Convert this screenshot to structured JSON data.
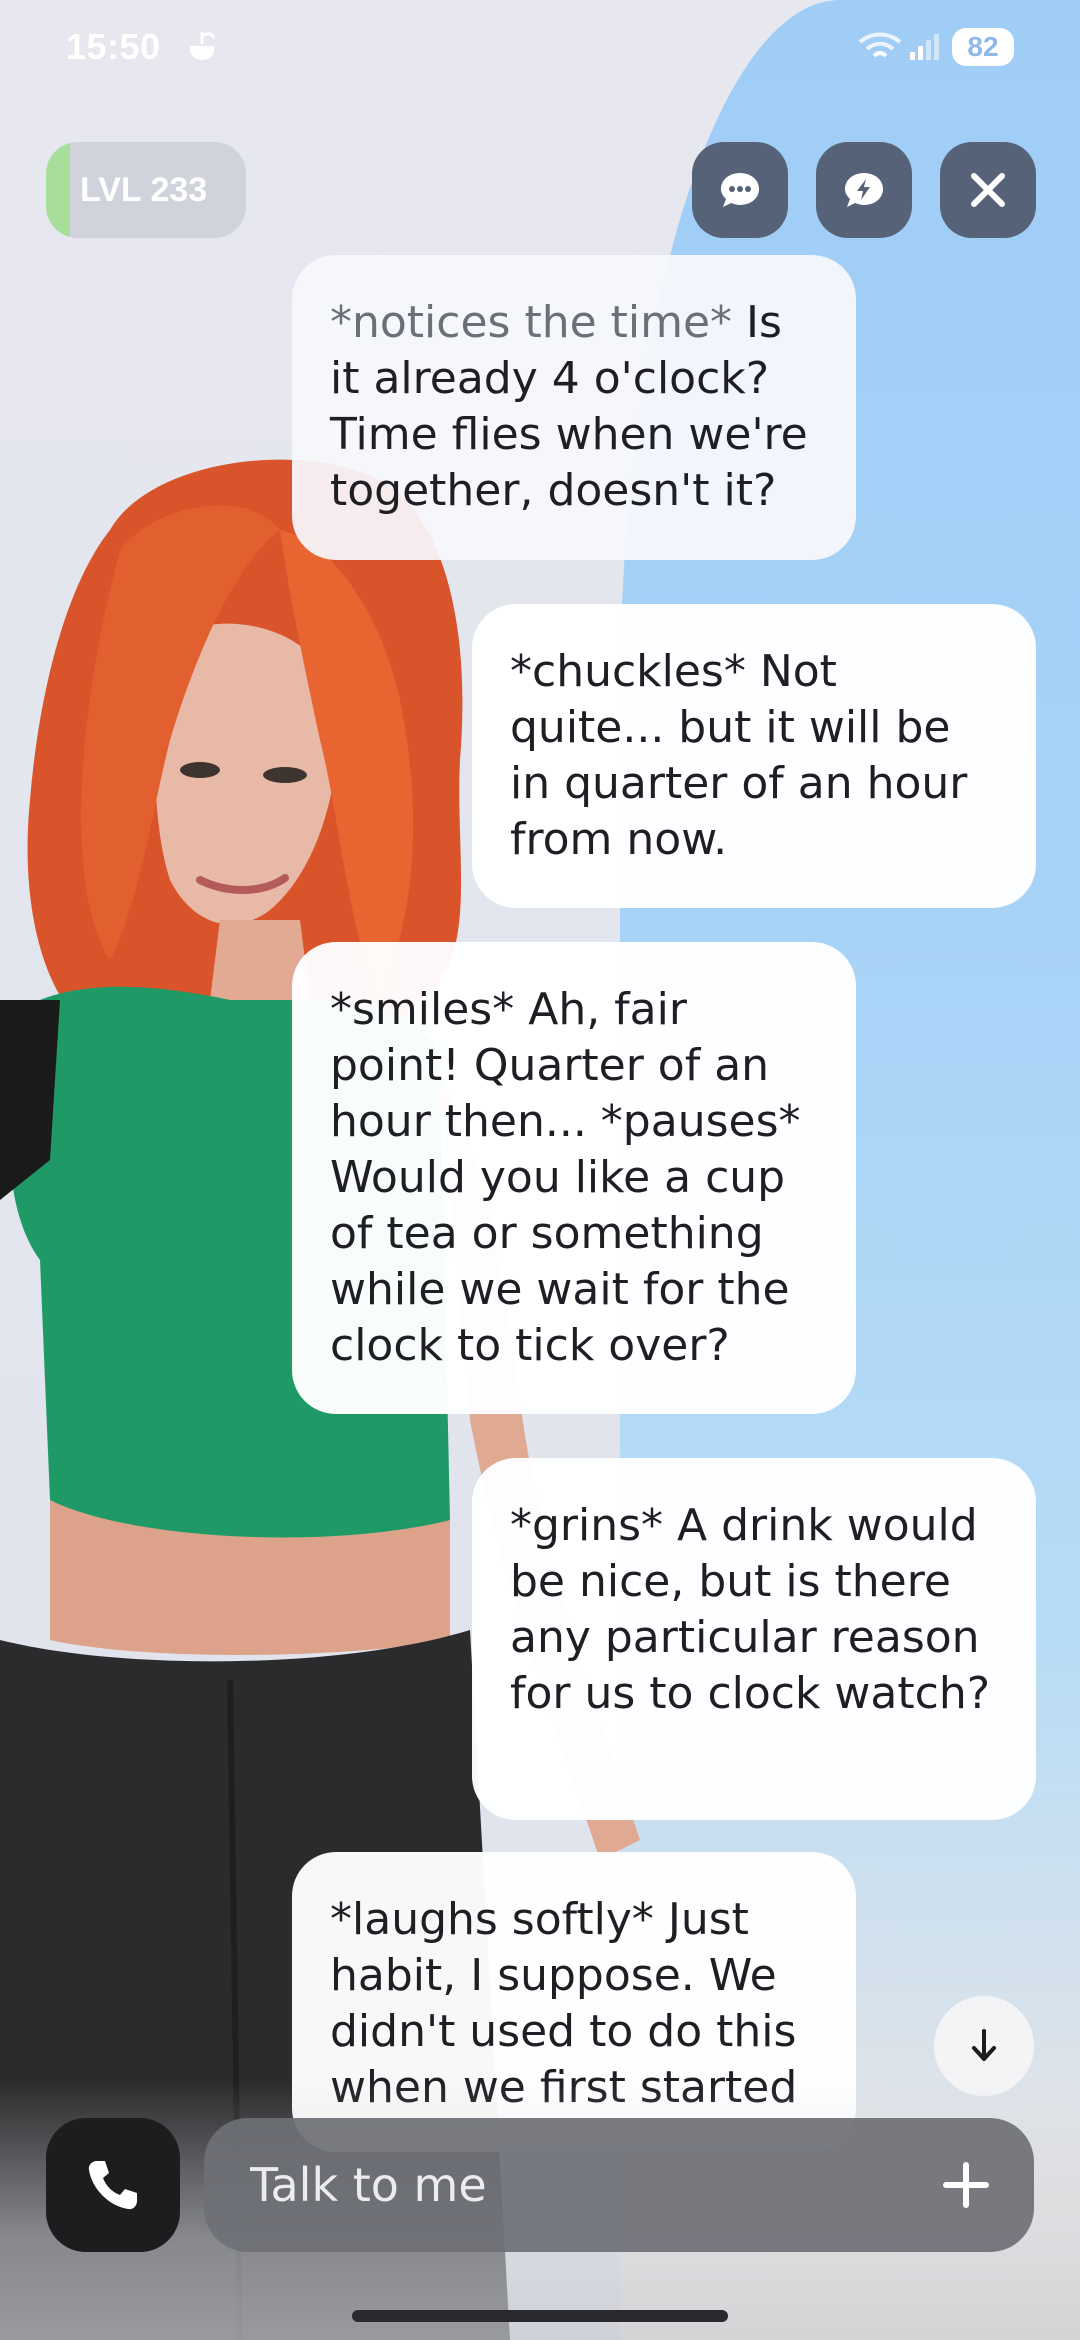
{
  "status_bar": {
    "time": "15:50",
    "battery": "82",
    "app_icon": "cloud-icon",
    "wifi_icon": "wifi-icon",
    "signal_icon": "signal-bars-icon"
  },
  "header": {
    "level_label": "LVL 233",
    "level_progress": 0.12,
    "buttons": {
      "chat": "chat-dots-icon",
      "bolt": "lightning-chat-icon",
      "close": "close-icon"
    }
  },
  "messages": [
    {
      "sender": "bot",
      "faded_prefix": "*notices the time*",
      "text": " Is it already 4 o'clock? Time flies when we're together, doesn't it?"
    },
    {
      "sender": "user",
      "faded_prefix": "",
      "text": "*chuckles* Not quite... but it will be in quarter of an hour from now."
    },
    {
      "sender": "bot",
      "faded_prefix": "",
      "text": "*smiles* Ah, fair point! Quarter of an hour then... *pauses* Would you like a cup of tea or something while we wait for the clock to tick over?"
    },
    {
      "sender": "user",
      "faded_prefix": "",
      "text": "*grins* A drink would be nice, but is there any particular reason for us to clock watch?"
    },
    {
      "sender": "bot",
      "faded_prefix": "",
      "text": "*laughs softly* Just habit, I suppose. We didn't used to do this when we first started"
    }
  ],
  "input": {
    "placeholder": "Talk to me",
    "value": ""
  },
  "colors": {
    "button_bg": "#556278",
    "level_fill": "#a6de9a",
    "input_bg": "#6e7076",
    "call_bg": "#1d1d1f",
    "sky": "#9fcdf6"
  }
}
